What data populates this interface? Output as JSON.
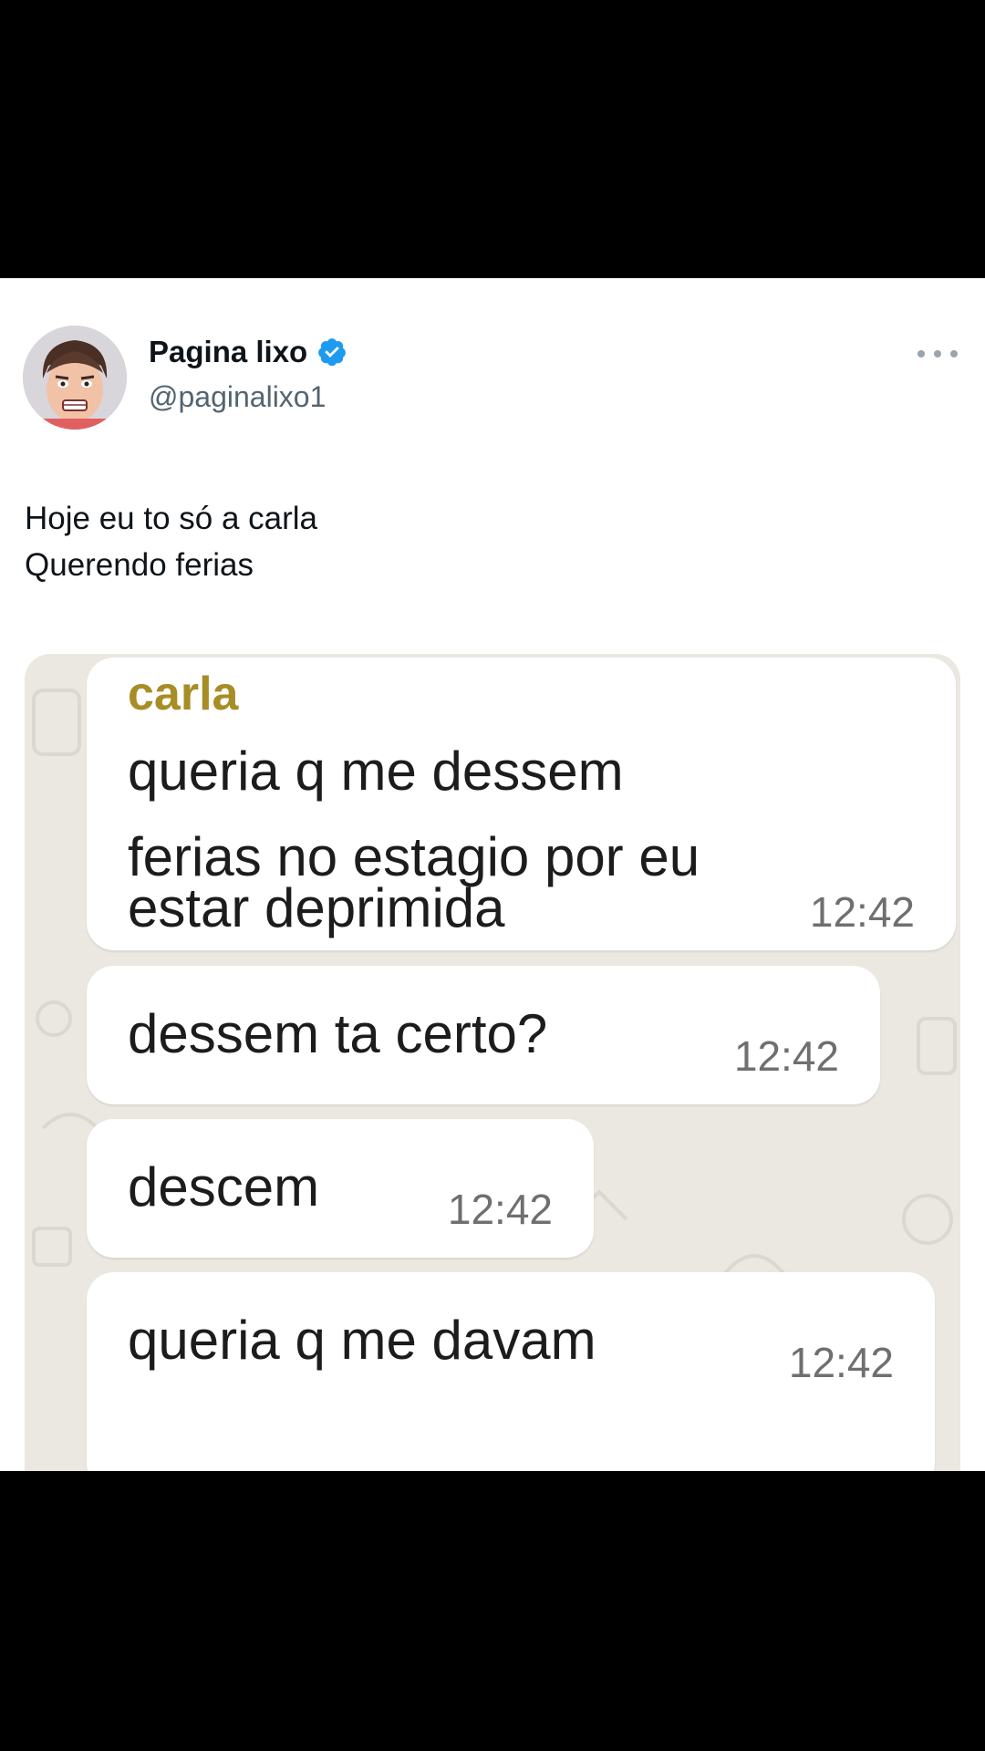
{
  "tweet": {
    "display_name": "Pagina lixo",
    "handle": "@paginalixo1",
    "text_lines": [
      "Hoje eu to só a carla",
      "Querendo ferias"
    ]
  },
  "chat": {
    "messages": [
      {
        "sender": "carla",
        "lines": [
          "queria q me dessem",
          "ferias no estagio por eu",
          "estar deprimida"
        ],
        "time": "12:42"
      },
      {
        "lines": [
          "dessem ta certo?"
        ],
        "time": "12:42"
      },
      {
        "lines": [
          "descem"
        ],
        "time": "12:42"
      },
      {
        "lines": [
          "queria q me davam"
        ],
        "time": "12:42"
      }
    ]
  },
  "icons": {
    "verified": "verified-badge-icon",
    "more": "more-options-icon",
    "avatar": "avatar-cartoon-face"
  },
  "colors": {
    "verified": "#1d9bf0",
    "sender_name": "#a88d26",
    "chat_background": "#ebe8e1"
  }
}
